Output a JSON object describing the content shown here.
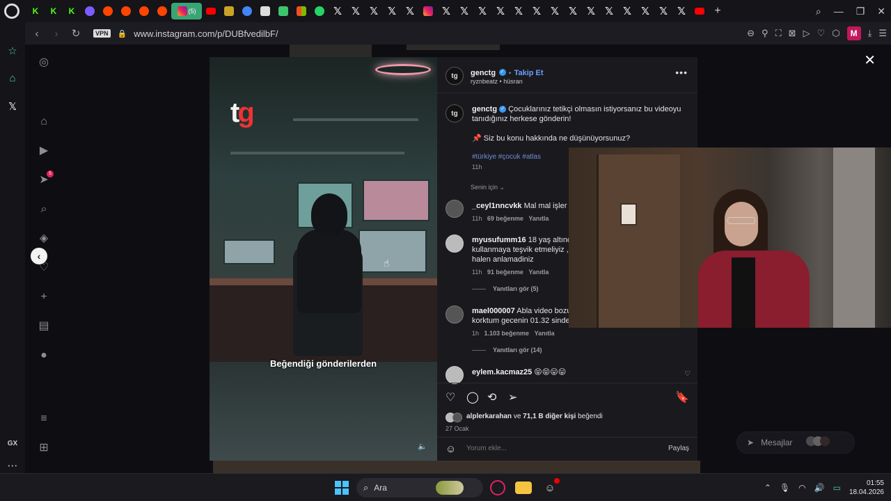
{
  "browser": {
    "url": "www.instagram.com/p/DUBfvedilbF/",
    "vpn_label": "VPN",
    "active_tab_badge": "(5)",
    "profile_letter": "M",
    "sidebar_label": "GX"
  },
  "instagram": {
    "post": {
      "author": "genctg",
      "follow_label": "Takip Et",
      "audio_artist": "ryznbeatz",
      "audio_track": "hüsran",
      "subtitle": "Beğendiği gönderilerden",
      "logo_t": "t",
      "logo_g": "g",
      "caption_line1": "Çocuklarınız tetikçi olmasın istiyorsanız bu videoyu",
      "caption_line2": "tanıdığınız herkese gönderin!",
      "caption_question": "📌 Siz bu konu hakkında ne düşünüyorsunuz?",
      "hashtags": "#türkiye #çocuk #atlas",
      "caption_time": "11h",
      "sort_label": "Senin için",
      "liked_by_user": "alplerkarahan",
      "liked_by_middle": "ve",
      "liked_by_others": "71,1 B diğer kişi",
      "liked_by_suffix": "beğendi",
      "date": "27 Ocak",
      "comment_placeholder": "Yorum ekle...",
      "share_label": "Paylaş"
    },
    "comments": [
      {
        "user": "_ceyl1nncvkk",
        "text": "Mal mal işler aq",
        "time": "11h",
        "likes": "69 beğenme",
        "reply": "Yanıtla"
      },
      {
        "user": "myusufumm16",
        "text": "18 yaş altındal",
        "text2": "kullanmaya teşvik etmeliyiz , y",
        "text3": "halen anlamadiniz",
        "time": "11h",
        "likes": "91 beğenme",
        "reply": "Yanıtla",
        "replies": "Yanıtları gör (5)"
      },
      {
        "user": "mael000007",
        "text": "Abla video bozul",
        "text2": "korktum gecenin 01.32 sinde",
        "time": "1h",
        "likes": "1.103 beğenme",
        "reply": "Yanıtla",
        "replies": "Yanıtları gör (14)"
      },
      {
        "user": "eylem.kacmaz25",
        "text": "😝😝😛😛"
      }
    ],
    "messages_label": "Mesajlar",
    "notification_count": "5"
  },
  "taskbar": {
    "search_label": "Ara",
    "time": "01:55",
    "date": "18.04.2026"
  },
  "colors": {
    "accent_green": "#3aa574",
    "link_blue": "#6e9cff",
    "verified_blue": "#3897f0",
    "opera_red": "#c2185b"
  }
}
